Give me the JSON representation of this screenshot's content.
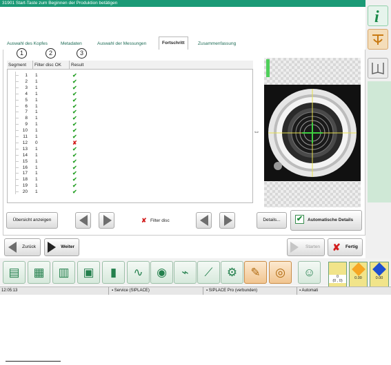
{
  "title": "31901 Start-Taste zum Beginnen der Produktion betätigen",
  "tabs": [
    "Auswahl des Kopfes",
    "Metadaten",
    "Auswahl der Messungen",
    "Fortschritt",
    "Zusammenfassung"
  ],
  "callouts": [
    "1",
    "2",
    "3",
    "4"
  ],
  "table": {
    "headers": [
      "Segment",
      "Filter disc OK",
      "Result"
    ],
    "rows": [
      {
        "segment": "1",
        "filter": "1",
        "result": "✔"
      },
      {
        "segment": "2",
        "filter": "1",
        "result": "✔"
      },
      {
        "segment": "3",
        "filter": "1",
        "result": "✔"
      },
      {
        "segment": "4",
        "filter": "1",
        "result": "✔"
      },
      {
        "segment": "5",
        "filter": "1",
        "result": "✔"
      },
      {
        "segment": "6",
        "filter": "1",
        "result": "✔"
      },
      {
        "segment": "7",
        "filter": "1",
        "result": "✔"
      },
      {
        "segment": "8",
        "filter": "1",
        "result": "✔"
      },
      {
        "segment": "9",
        "filter": "1",
        "result": "✔"
      },
      {
        "segment": "10",
        "filter": "1",
        "result": "✔"
      },
      {
        "segment": "11",
        "filter": "1",
        "result": "✔"
      },
      {
        "segment": "12",
        "filter": "0",
        "result": "✘"
      },
      {
        "segment": "13",
        "filter": "1",
        "result": "✔"
      },
      {
        "segment": "14",
        "filter": "1",
        "result": "✔"
      },
      {
        "segment": "15",
        "filter": "1",
        "result": "✔"
      },
      {
        "segment": "16",
        "filter": "1",
        "result": "✔"
      },
      {
        "segment": "17",
        "filter": "1",
        "result": "✔"
      },
      {
        "segment": "18",
        "filter": "1",
        "result": "✔"
      },
      {
        "segment": "19",
        "filter": "1",
        "result": "✔"
      },
      {
        "segment": "20",
        "filter": "1",
        "result": "✔"
      }
    ]
  },
  "buttons": {
    "overview": "Übersicht anzeigen",
    "filter": "Filter disc",
    "details": "Details...",
    "auto_details": "Automatische Details",
    "back": "Zurück",
    "next": "Weiter",
    "start": "Starten",
    "finish": "Fertig"
  },
  "status": {
    "time": "12:05:13",
    "service": "Service (SIPLACE)",
    "siplace": "SIPLACE Pro (verbunden)",
    "auto": "Automati"
  },
  "gauges": {
    "g1_value": "0",
    "g1_coords": "(0 , 0)",
    "g2_value": "0.00",
    "g3_value": "0.00"
  },
  "colors": {
    "accent": "#1b9a76",
    "ok": "#26a026",
    "error": "#d21c1c",
    "orange": "#f1c591"
  }
}
